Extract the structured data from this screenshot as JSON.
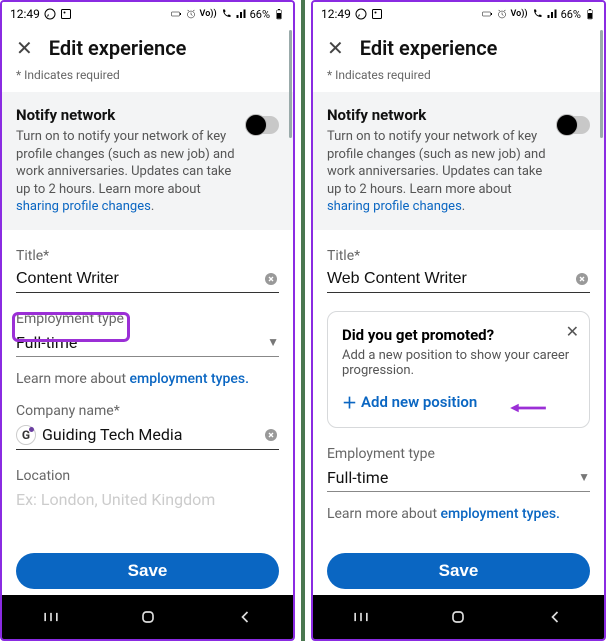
{
  "status": {
    "time": "12:49",
    "battery": "66%"
  },
  "header": {
    "title": "Edit experience",
    "required_note": "* Indicates required"
  },
  "notify": {
    "heading": "Notify network",
    "body_prefix": "Turn on to notify your network of key profile changes (such as new job) and work anniversaries. Updates can take up to 2 hours. Learn more about ",
    "link_text": "sharing profile changes",
    "period": "."
  },
  "left": {
    "title_label": "Title*",
    "title_value": "Content Writer",
    "emp_label": "Employment type",
    "emp_value": "Full-time",
    "learn_prefix": "Learn more about ",
    "learn_link": "employment types.",
    "company_label": "Company name*",
    "company_value": "Guiding Tech Media",
    "location_label": "Location",
    "location_faded": "Ex: London, United Kingdom"
  },
  "right": {
    "title_label": "Title*",
    "title_value": "Web Content Writer",
    "promo_heading": "Did you get promoted?",
    "promo_body": "Add a new position to show your career progression.",
    "promo_add": "Add new position",
    "emp_label": "Employment type",
    "emp_value": "Full-time",
    "learn_prefix": "Learn more about ",
    "learn_link": "employment types."
  },
  "save_label": "Save"
}
